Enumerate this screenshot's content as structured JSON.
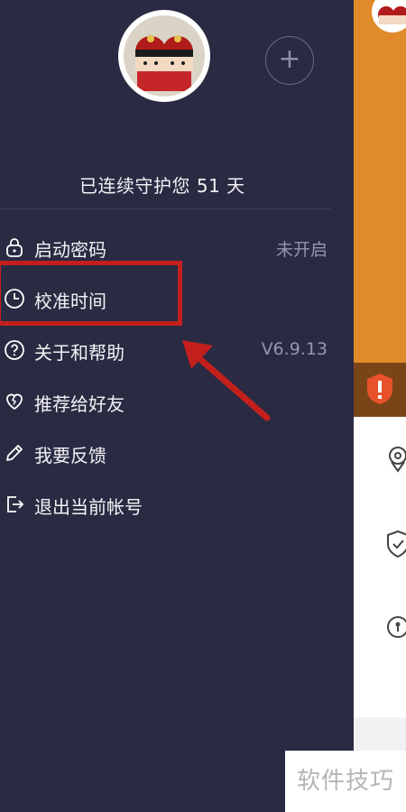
{
  "drawer": {
    "add_label": "+",
    "protect_text": "已连续守护您 51 天",
    "menu": [
      {
        "label": "启动密码",
        "value": "未开启",
        "icon": "lock-icon"
      },
      {
        "label": "校准时间",
        "value": "",
        "icon": "clock-icon"
      },
      {
        "label": "关于和帮助",
        "value": "V6.9.13",
        "icon": "help-icon"
      },
      {
        "label": "推荐给好友",
        "value": "",
        "icon": "heart-icon"
      },
      {
        "label": "我要反馈",
        "value": "",
        "icon": "pencil-icon"
      },
      {
        "label": "退出当前帐号",
        "value": "",
        "icon": "logout-icon"
      }
    ]
  },
  "highlight_color": "#c3201d",
  "watermark": "软件技巧",
  "colors": {
    "drawer_bg": "#2a2b42",
    "accent_orange": "#e08a2b",
    "accent_brown": "#7a4516"
  }
}
